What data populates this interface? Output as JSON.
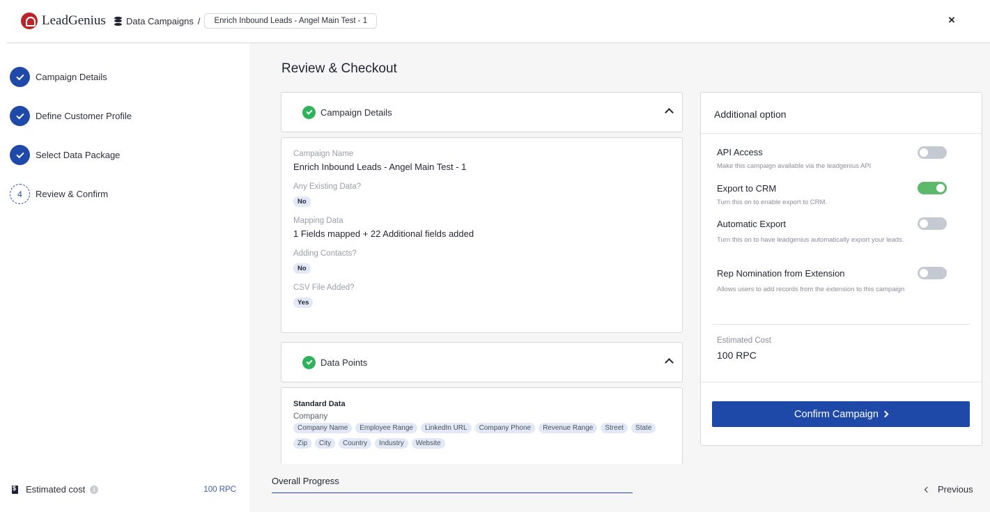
{
  "header": {
    "brand": "LeadGenius",
    "breadcrumb_root": "Data Campaigns",
    "breadcrumb_sep": "/",
    "breadcrumb_current": "Enrich Inbound Leads - Angel Main Test - 1",
    "close_label": "×"
  },
  "sidebar": {
    "steps": [
      {
        "label": "Campaign Details",
        "status": "done"
      },
      {
        "label": "Define Customer Profile",
        "status": "done"
      },
      {
        "label": "Select Data Package",
        "status": "done"
      },
      {
        "label": "Review & Confirm",
        "status": "current",
        "number": "4"
      }
    ],
    "estimated_cost_label": "Estimated cost",
    "estimated_cost_value": "100 RPC"
  },
  "main": {
    "title": "Review & Checkout",
    "campaign_section": {
      "title": "Campaign Details",
      "fields": {
        "name_label": "Campaign Name",
        "name_value": "Enrich Inbound Leads - Angel Main Test - 1",
        "existing_label": "Any Existing Data?",
        "existing_value": "No",
        "mapping_label": "Mapping Data",
        "mapping_value": "1 Fields mapped + 22 Additional fields added",
        "contacts_label": "Adding Contacts?",
        "contacts_value": "No",
        "csv_label": "CSV File Added?",
        "csv_value": "Yes"
      }
    },
    "points_section": {
      "title": "Data Points",
      "group_title": "Standard Data",
      "subgroup": "Company",
      "chips": [
        "Company Name",
        "Employee Range",
        "LinkedIn URL",
        "Company Phone",
        "Revenue Range",
        "Street",
        "State",
        "Zip",
        "City",
        "Country",
        "Industry",
        "Website"
      ]
    },
    "progress_label": "Overall Progress",
    "previous_label": "Previous"
  },
  "options": {
    "title": "Additional option",
    "items": [
      {
        "name": "API Access",
        "desc": "Make this campaign available via the leadgenius API",
        "on": false
      },
      {
        "name": "Export to CRM",
        "desc": "Turn this on to enable export to CRM.",
        "on": true
      },
      {
        "name": "Automatic Export",
        "desc": "Turn this on to have leadgenius automatically export your leads.",
        "on": false
      },
      {
        "name": "Rep Nomination from Extension",
        "desc": "Allows users to add records from the extension to this campaign",
        "on": false
      }
    ],
    "cost_label": "Estimated Cost",
    "cost_value": "100 RPC",
    "confirm_label": "Confirm Campaign"
  }
}
